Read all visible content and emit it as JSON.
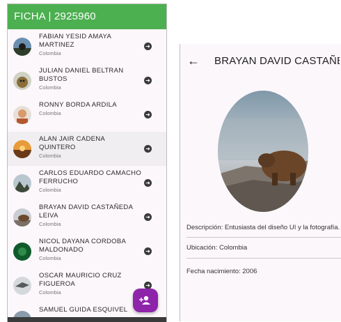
{
  "list_screen": {
    "title": "FICHA | 2925960",
    "people": [
      {
        "name": "FABIAN YESID AMAYA MARTINEZ",
        "country": "Colombia",
        "avatar_icon": "landscape-avatar"
      },
      {
        "name": "JULIAN DANIEL BELTRAN BUSTOS",
        "country": "Colombia",
        "avatar_icon": "cat-avatar"
      },
      {
        "name": "RONNY BORDA ARDILA",
        "country": "Colombia",
        "avatar_icon": "person-avatar"
      },
      {
        "name": "ALAN JAIR CADENA QUINTERO",
        "country": "Colombia",
        "avatar_icon": "sunset-avatar"
      },
      {
        "name": "CARLOS EDUARDO CAMACHO FERRUCHO",
        "country": "Colombia",
        "avatar_icon": "mountain-avatar"
      },
      {
        "name": "BRAYAN DAVID CASTAÑEDA LEIVA",
        "country": "Colombia",
        "avatar_icon": "bear-avatar"
      },
      {
        "name": "NICOL DAYANA CORDOBA MALDONADO",
        "country": "Colombia",
        "avatar_icon": "green-avatar"
      },
      {
        "name": "OSCAR MAURICIO CRUZ FIGUEROA",
        "country": "Colombia",
        "avatar_icon": "bird-avatar"
      },
      {
        "name": "SAMUEL GUIDA ESQUIVEL",
        "country": "",
        "avatar_icon": "landscape-avatar"
      }
    ],
    "fab_icon": "add-person-icon"
  },
  "detail_screen": {
    "title": "BRAYAN DAVID CASTAÑE...",
    "back_icon": "back-arrow-icon",
    "photo_icon": "bear-photo",
    "description": "Descripción: Entusiasta del diseño UI y la fotografía.",
    "location": "Ubicación: Colombia",
    "birth": "Fecha nacimiento: 2006"
  },
  "colors": {
    "appbar": "#4caf50",
    "fab": "#8e24aa",
    "background": "#fcf7fb"
  }
}
